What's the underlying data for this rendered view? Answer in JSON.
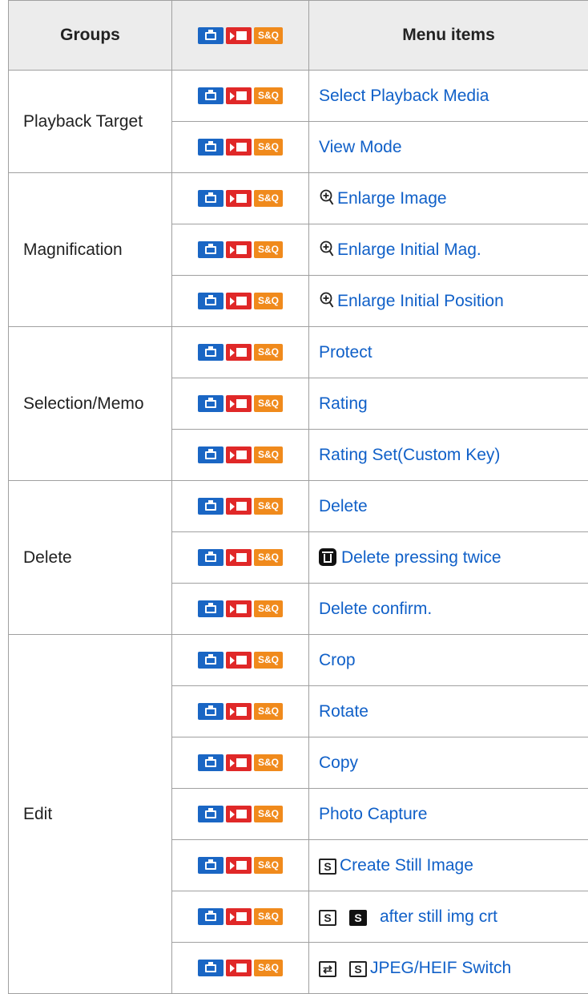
{
  "header": {
    "groups": "Groups",
    "menu_items": "Menu items",
    "badge_sq": "S&Q"
  },
  "badge_colors": {
    "photo": "#1a66c4",
    "movie": "#e02828",
    "sq": "#f08a1c"
  },
  "link_color": "#1060c8",
  "groups": [
    {
      "name": "Playback Target",
      "items": [
        {
          "label": "Select Playback Media",
          "icons": []
        },
        {
          "label": "View Mode",
          "icons": []
        }
      ]
    },
    {
      "name": "Magnification",
      "items": [
        {
          "label": "Enlarge Image",
          "icons": [
            "magnify-plus-icon"
          ]
        },
        {
          "label": "Enlarge Initial Mag.",
          "icons": [
            "magnify-plus-icon"
          ]
        },
        {
          "label": "Enlarge Initial Position",
          "icons": [
            "magnify-plus-icon"
          ]
        }
      ]
    },
    {
      "name": "Selection/Memo",
      "items": [
        {
          "label": "Protect",
          "icons": []
        },
        {
          "label": "Rating",
          "icons": []
        },
        {
          "label": "Rating Set(Custom Key)",
          "icons": []
        }
      ]
    },
    {
      "name": "Delete",
      "items": [
        {
          "label": "Delete",
          "icons": []
        },
        {
          "label": "Delete pressing twice",
          "icons": [
            "trash-icon"
          ]
        },
        {
          "label": "Delete confirm.",
          "icons": []
        }
      ]
    },
    {
      "name": "Edit",
      "items": [
        {
          "label": "Crop",
          "icons": []
        },
        {
          "label": "Rotate",
          "icons": []
        },
        {
          "label": "Copy",
          "icons": []
        },
        {
          "label": "Photo Capture",
          "icons": []
        },
        {
          "label": "Create Still Image",
          "icons": [
            "create-still-icon"
          ]
        },
        {
          "label": "after still img crt",
          "icons": [
            "create-still-icon",
            "still-s-icon"
          ]
        },
        {
          "label": "JPEG/HEIF Switch",
          "icons": [
            "jpeg-heif-icon",
            "create-still-icon"
          ]
        }
      ]
    }
  ]
}
